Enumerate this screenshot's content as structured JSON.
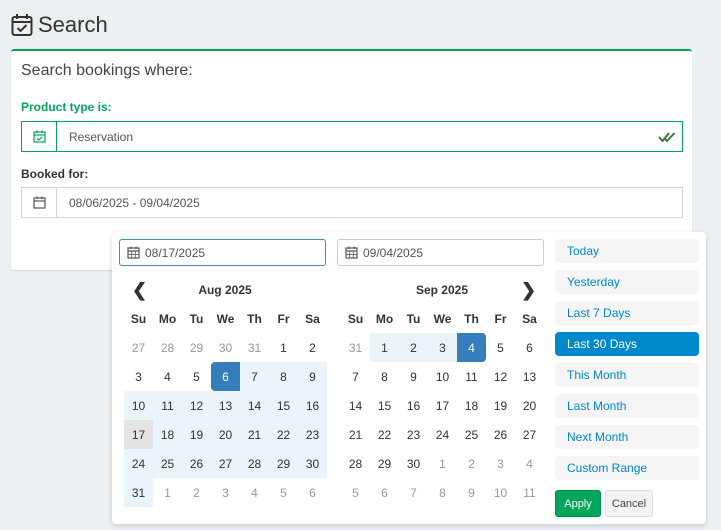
{
  "header": {
    "title": "Search"
  },
  "box": {
    "title": "Search bookings where:",
    "product_label": "Product type is:",
    "product_value": "Reservation",
    "booked_label": "Booked for:",
    "booked_value": "08/06/2025 - 09/04/2025"
  },
  "picker": {
    "start_input": "08/17/2025",
    "end_input": "09/04/2025",
    "left_month": "Aug 2025",
    "right_month": "Sep 2025",
    "weekdays": [
      "Su",
      "Mo",
      "Tu",
      "We",
      "Th",
      "Fr",
      "Sa"
    ],
    "left_weeks": [
      [
        "27",
        "28",
        "29",
        "30",
        "31",
        "1",
        "2"
      ],
      [
        "3",
        "4",
        "5",
        "6",
        "7",
        "8",
        "9"
      ],
      [
        "10",
        "11",
        "12",
        "13",
        "14",
        "15",
        "16"
      ],
      [
        "17",
        "18",
        "19",
        "20",
        "21",
        "22",
        "23"
      ],
      [
        "24",
        "25",
        "26",
        "27",
        "28",
        "29",
        "30"
      ],
      [
        "31",
        "1",
        "2",
        "3",
        "4",
        "5",
        "6"
      ]
    ],
    "right_weeks": [
      [
        "31",
        "1",
        "2",
        "3",
        "4",
        "5",
        "6"
      ],
      [
        "7",
        "8",
        "9",
        "10",
        "11",
        "12",
        "13"
      ],
      [
        "14",
        "15",
        "16",
        "17",
        "18",
        "19",
        "20"
      ],
      [
        "21",
        "22",
        "23",
        "24",
        "25",
        "26",
        "27"
      ],
      [
        "28",
        "29",
        "30",
        "1",
        "2",
        "3",
        "4"
      ],
      [
        "5",
        "6",
        "7",
        "8",
        "9",
        "10",
        "11"
      ]
    ],
    "ranges": [
      "Today",
      "Yesterday",
      "Last 7 Days",
      "Last 30 Days",
      "This Month",
      "Last Month",
      "Next Month",
      "Custom Range"
    ],
    "active_range": "Last 30 Days",
    "apply_label": "Apply",
    "cancel_label": "Cancel"
  },
  "colors": {
    "accent_green": "#00a65a",
    "accent_blue": "#357ebd",
    "range_blue": "#0088cc"
  }
}
